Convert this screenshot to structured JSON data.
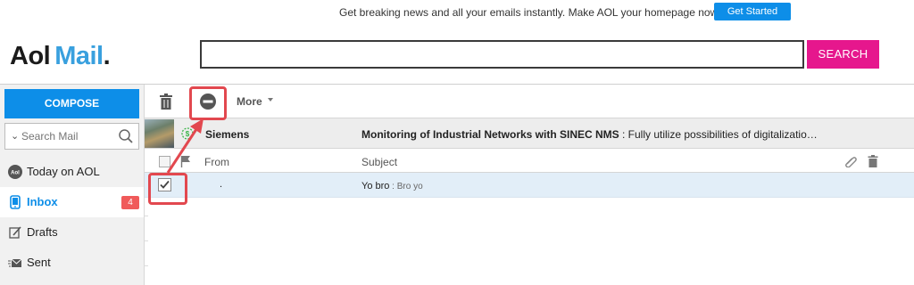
{
  "promo": {
    "text": "Get breaking news and all your emails instantly. Make AOL your homepage now.",
    "button_label": "Get Started"
  },
  "logo": {
    "aol": "Aol",
    "mail": "Mail",
    "dot": "."
  },
  "search": {
    "value": "",
    "button_label": "SEARCH"
  },
  "sidebar": {
    "compose_label": "COMPOSE",
    "search_placeholder": "Search Mail",
    "items": [
      {
        "label": "Today on AOL",
        "icon": "aol-icon"
      },
      {
        "label": "Inbox",
        "icon": "tablet-icon",
        "badge": "4",
        "active": true
      },
      {
        "label": "Drafts",
        "icon": "draft-edit-icon"
      },
      {
        "label": "Sent",
        "icon": "sent-mail-icon"
      }
    ]
  },
  "toolbar": {
    "more_label": "More"
  },
  "featured": {
    "sender": "Siemens",
    "subject": "Monitoring of Industrial Networks with SINEC NMS",
    "preview": " : Fully utilize possibilities of digitalizatio…"
  },
  "list_header": {
    "from_label": "From",
    "subject_label": "Subject"
  },
  "messages": [
    {
      "sender": ".",
      "subject": "Yo bro",
      "preview": " : Bro yo",
      "checked": true
    }
  ],
  "colors": {
    "accent_blue": "#0d8ee8",
    "search_pink": "#e6178d",
    "callout_red": "#e2484f",
    "badge_red": "#f05a5a",
    "selected_row": "#e2eef8"
  }
}
